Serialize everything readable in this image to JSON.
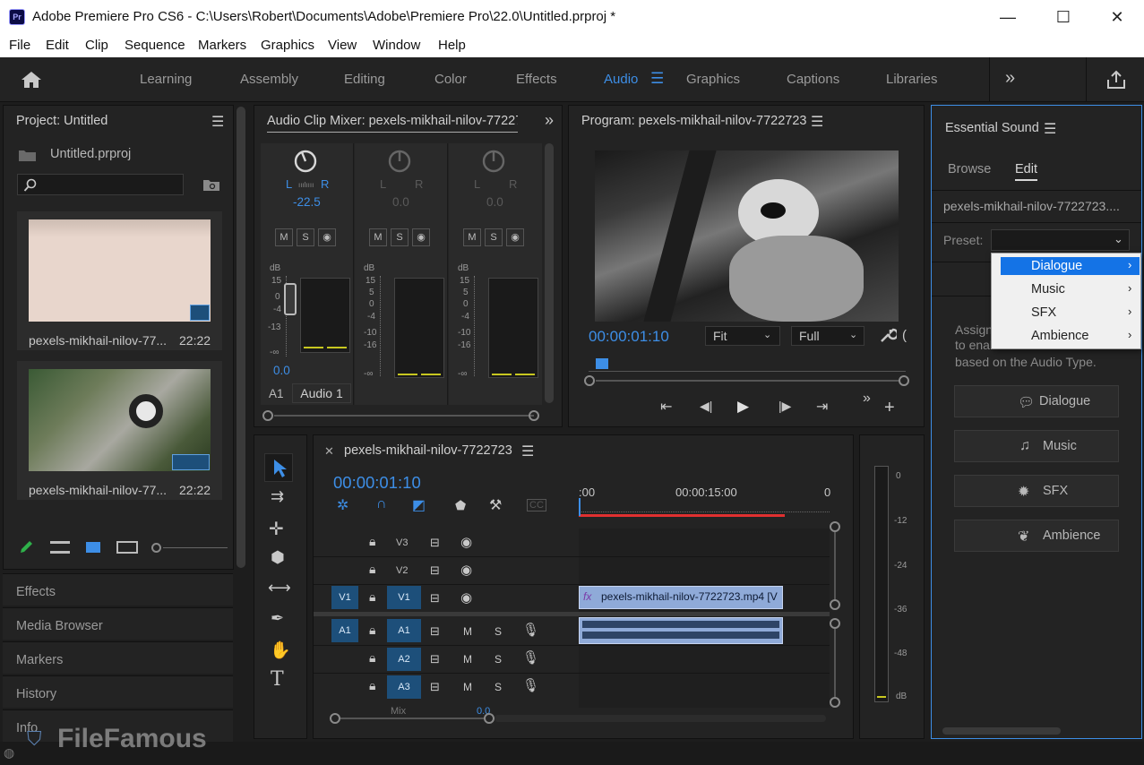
{
  "window": {
    "app_icon": "Pr",
    "title": "Adobe Premiere Pro CS6   - C:\\Users\\Robert\\Documents\\Adobe\\Premiere Pro\\22.0\\Untitled.prproj *",
    "minimize": "—",
    "maximize": "☐",
    "close": "✕"
  },
  "menu": [
    "File",
    "Edit",
    "Clip",
    "Sequence",
    "Markers",
    "Graphics",
    "View",
    "Window",
    "Help"
  ],
  "workspaces": {
    "items": [
      "Learning",
      "Assembly",
      "Editing",
      "Color",
      "Effects",
      "Audio",
      "Graphics",
      "Captions",
      "Libraries"
    ],
    "active": "Audio",
    "more": "»",
    "home_icon": "home-icon",
    "share_icon": "share-icon"
  },
  "project": {
    "title": "Project: Untitled",
    "file": "Untitled.prproj",
    "items": [
      {
        "name": "pexels-mikhail-nilov-77...",
        "duration": "22:22"
      },
      {
        "name": "pexels-mikhail-nilov-77...",
        "duration": "22:22"
      }
    ]
  },
  "side_panels": [
    "Effects",
    "Media Browser",
    "Markers",
    "History",
    "Info"
  ],
  "mixer": {
    "title": "Audio Clip Mixer: pexels-mikhail-nilov-77227",
    "channels": [
      {
        "l": "L",
        "r": "R",
        "pan": "-22.5",
        "vol": "0.0"
      },
      {
        "l": "L",
        "r": "R",
        "pan": "0.0"
      },
      {
        "l": "L",
        "r": "R",
        "pan": "0.0"
      }
    ],
    "msr": [
      "M",
      "S",
      "◉"
    ],
    "db_label": "dB",
    "ticks_ch1": [
      "15",
      "0",
      "-4",
      "-13",
      "-∞"
    ],
    "ticks": [
      "15",
      "5",
      "0",
      "-4",
      "-10",
      "-16",
      "-∞"
    ],
    "track_id": "A1",
    "track_name": "Audio 1"
  },
  "program": {
    "title": "Program: pexels-mikhail-nilov-7722723",
    "timecode": "00:00:01:10",
    "zoom": "Fit",
    "quality": "Full"
  },
  "timeline": {
    "tab": "pexels-mikhail-nilov-7722723",
    "timecode": "00:00:01:10",
    "ruler": [
      ":00",
      "00:00:15:00",
      "0"
    ],
    "video_tracks": [
      "V3",
      "V2",
      "V1"
    ],
    "audio_tracks": [
      "A1",
      "A2",
      "A3"
    ],
    "source_v": "V1",
    "source_a": "A1",
    "m": "M",
    "s": "S",
    "clip": "pexels-mikhail-nilov-7722723.mp4 [V",
    "fx": "fx",
    "master": "Mix",
    "master_val": "0.0"
  },
  "meter": {
    "ticks": [
      "0",
      "-12",
      "-24",
      "-36",
      "-48",
      "dB"
    ]
  },
  "essential_sound": {
    "title": "Essential Sound",
    "tabs": [
      "Browse",
      "Edit"
    ],
    "active_tab": "Edit",
    "clip": "pexels-mikhail-nilov-7722723....",
    "preset_label": "Preset:",
    "hint1": "Assign",
    "hint2": "to enab",
    "hint3": "based on the Audio Type.",
    "types": [
      "Dialogue",
      "Music",
      "SFX",
      "Ambience"
    ],
    "dropdown": [
      "Dialogue",
      "Music",
      "SFX",
      "Ambience"
    ]
  },
  "watermark": "FileFamous"
}
